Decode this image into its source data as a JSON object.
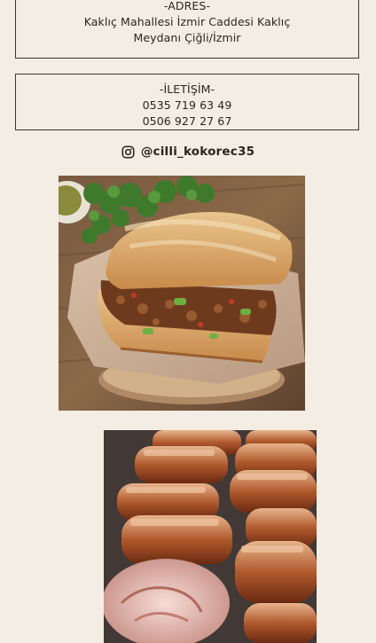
{
  "address": {
    "heading": "-ADRES-",
    "line1": "Kaklıç Mahallesi İzmir Caddesi Kaklıç",
    "line2": "Meydanı Çiğli/İzmir"
  },
  "contact": {
    "heading": "-İLETİŞİM-",
    "phone1": "0535 719 63 49",
    "phone2": "0506 927 27 67"
  },
  "instagram": {
    "icon": "instagram-icon",
    "handle": "@cilli_kokorec35"
  },
  "photos": [
    {
      "name": "kokorec-sandwich-photo"
    },
    {
      "name": "kokorec-grill-photo"
    }
  ]
}
